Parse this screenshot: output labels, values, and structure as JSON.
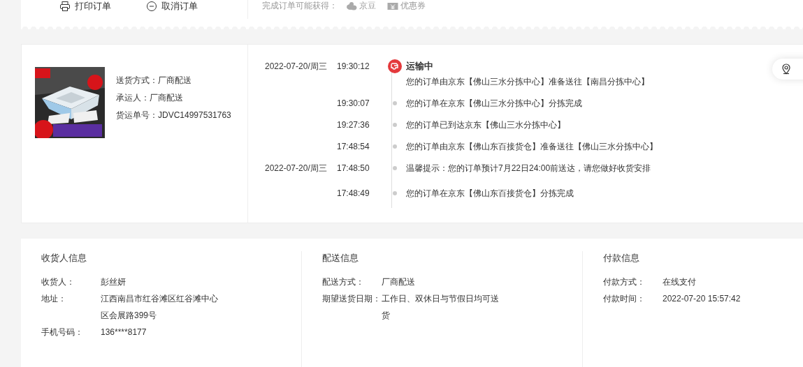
{
  "actions": [
    {
      "kind": "print",
      "label": "打印订单"
    },
    {
      "kind": "cancel",
      "label": "取消订单"
    }
  ],
  "rewards": {
    "label": "完成订单可能获得：",
    "items": [
      {
        "kind": "bean",
        "label": "京豆"
      },
      {
        "kind": "coupon",
        "label": "优惠券"
      }
    ]
  },
  "shipment": {
    "fields": [
      {
        "label": "送货方式：",
        "value": "厂商配送"
      },
      {
        "label": "承运人：",
        "value": "厂商配送"
      },
      {
        "label": "货运单号：",
        "value": "JDVC14997531763"
      }
    ]
  },
  "tracking": [
    {
      "date": "2022-07-20/周三",
      "time": "19:30:12",
      "current": true,
      "title": "运输中",
      "text": "您的订单由京东【佛山三水分拣中心】准备送往【南昌分拣中心】"
    },
    {
      "time": "19:30:07",
      "current": false,
      "text": "您的订单在京东【佛山三水分拣中心】分拣完成"
    },
    {
      "time": "19:27:36",
      "current": false,
      "text": "您的订单已到达京东【佛山三水分拣中心】"
    },
    {
      "time": "17:48:54",
      "current": false,
      "text": "您的订单由京东【佛山东百接货仓】准备送往【佛山三水分拣中心】"
    },
    {
      "date": "2022-07-20/周三",
      "time": "17:48:50",
      "current": false,
      "text": "温馨提示：您的订单预计7月22日24:00前送达，请您做好收货安排"
    },
    {
      "time": "17:48:49",
      "current": false,
      "text": "您的订单在京东【佛山东百接货仓】分拣完成"
    }
  ],
  "info_sections": [
    {
      "title": "收货人信息",
      "rows": [
        {
          "label": "收货人：",
          "value": "彭丝妍"
        },
        {
          "label": "地址：",
          "value": "江西南昌市红谷滩区红谷滩中心区会展路399号"
        },
        {
          "label": "手机号码：",
          "value": "136****8177"
        }
      ]
    },
    {
      "title": "配送信息",
      "rows": [
        {
          "label": "配送方式：",
          "value": "厂商配送"
        },
        {
          "label": "期望送货日期：",
          "value": "工作日、双休日与节假日均可送货"
        }
      ]
    },
    {
      "title": "付款信息",
      "rows": [
        {
          "label": "付款方式：",
          "value": "在线支付"
        },
        {
          "label": "付款时间：",
          "value": "2022-07-20 15:57:42"
        }
      ]
    }
  ]
}
